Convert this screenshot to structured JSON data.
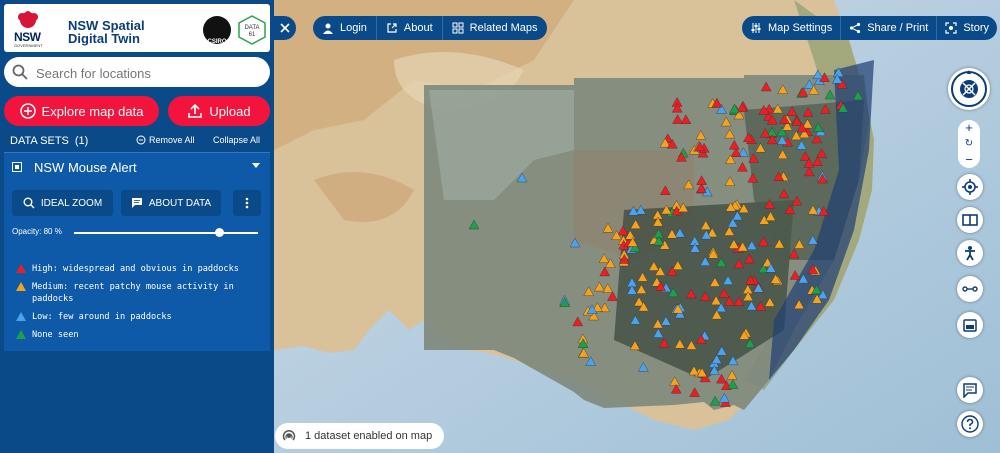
{
  "header": {
    "logo_text": "NSW",
    "logo_subtext": "GOVERNMENT",
    "title": "NSW Spatial Digital Twin",
    "partner1": "CSIRO",
    "partner2": "DATA 61"
  },
  "search": {
    "placeholder": "Search for locations",
    "value": ""
  },
  "actions": {
    "explore": "Explore map data",
    "upload": "Upload"
  },
  "datasets": {
    "title": "DATA SETS",
    "count": "(1)",
    "remove_all": "Remove All",
    "collapse_all": "Collapse All",
    "items": [
      {
        "name": "NSW Mouse Alert",
        "ideal_zoom": "IDEAL ZOOM",
        "about_data": "ABOUT DATA",
        "opacity_label": "Opacity: 80 %",
        "opacity": 0.8,
        "legend": [
          {
            "label": "High: widespread and obvious in paddocks",
            "color": "#ee1d23"
          },
          {
            "label": "Medium: recent patchy mouse activity in paddocks",
            "color": "#f7a21b"
          },
          {
            "label": "Low: few around in paddocks",
            "color": "#4aa3f0"
          },
          {
            "label": "None seen",
            "color": "#1aa14a"
          }
        ]
      }
    ]
  },
  "topnav": {
    "login": "Login",
    "about": "About",
    "related": "Related Maps"
  },
  "topright": {
    "settings": "Map Settings",
    "share": "Share / Print",
    "story": "Story"
  },
  "status": {
    "text": "1 dataset enabled on map"
  },
  "colors": {
    "primary": "#0b4a88",
    "accent": "#f2143c",
    "panel": "#0f5aa8"
  },
  "icons": [
    "search-icon",
    "plus-circle-icon",
    "upload-icon",
    "minus-circle-icon",
    "zoom-icon",
    "about-icon",
    "more-icon",
    "close-icon",
    "user-icon",
    "external-icon",
    "grid-icon",
    "settings-icon",
    "share-icon",
    "story-icon",
    "compass-icon",
    "locate-icon",
    "split-icon",
    "accessibility-icon",
    "measure-icon",
    "print-icon",
    "feedback-icon",
    "help-icon",
    "dataset-icon"
  ]
}
